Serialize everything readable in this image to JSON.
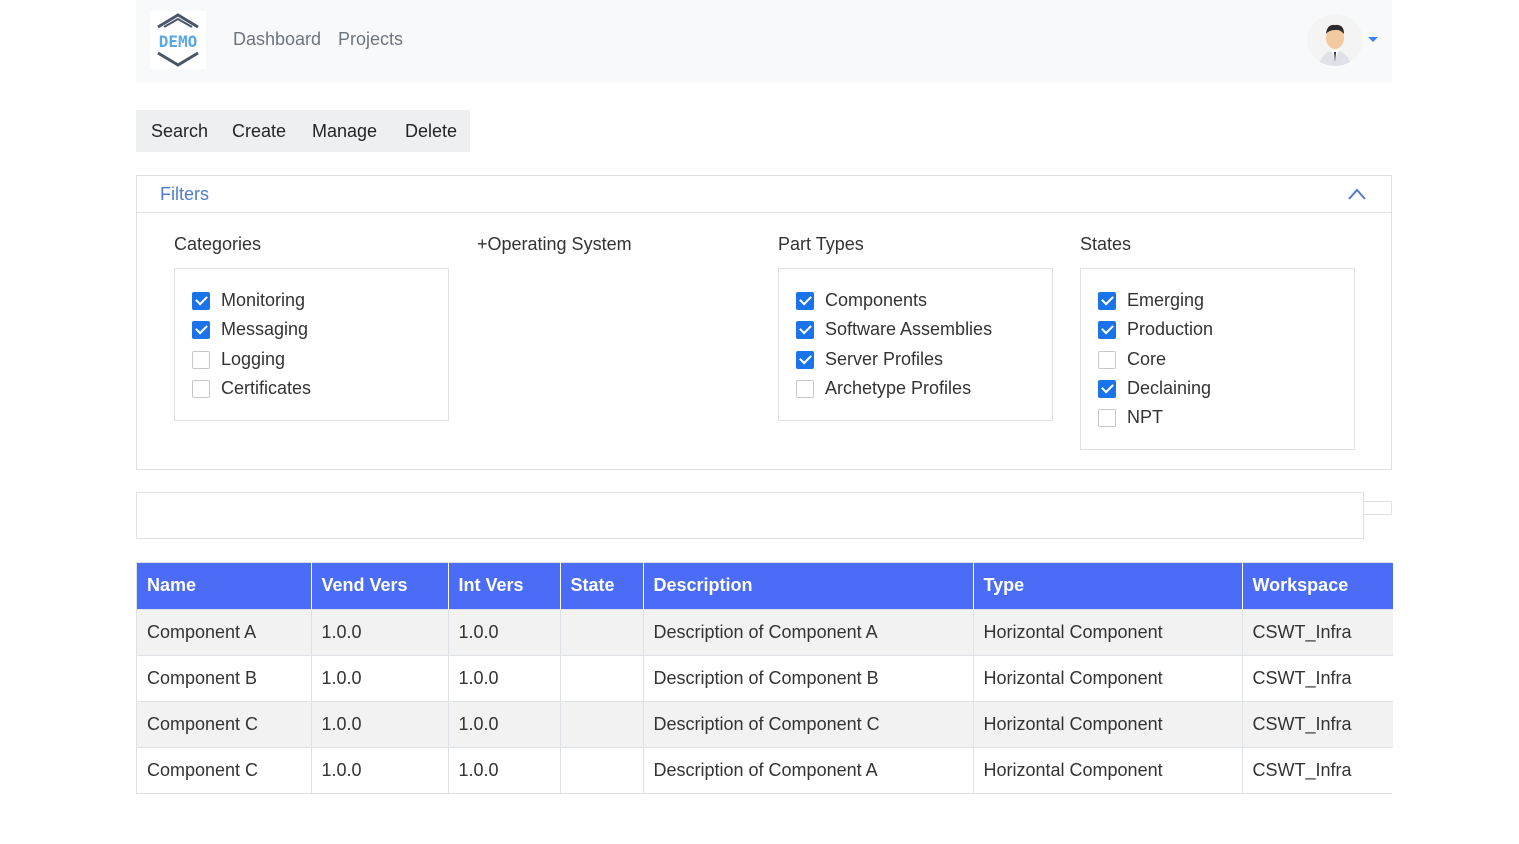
{
  "header": {
    "logo_text": "DEMO",
    "nav": [
      {
        "label": "Dashboard"
      },
      {
        "label": "Projects"
      }
    ]
  },
  "actions": [
    {
      "label": "Search"
    },
    {
      "label": "Create"
    },
    {
      "label": "Manage"
    },
    {
      "label": "Delete"
    }
  ],
  "filters": {
    "title": "Filters",
    "categories": {
      "label": "Categories",
      "items": [
        {
          "label": "Monitoring",
          "checked": true
        },
        {
          "label": "Messaging",
          "checked": true
        },
        {
          "label": "Logging",
          "checked": false
        },
        {
          "label": "Certificates",
          "checked": false
        }
      ]
    },
    "operating_system": {
      "label": "+Operating System"
    },
    "part_types": {
      "label": "Part Types",
      "items": [
        {
          "label": "Components",
          "checked": true
        },
        {
          "label": "Software Assemblies",
          "checked": true
        },
        {
          "label": "Server Profiles",
          "checked": true
        },
        {
          "label": "Archetype Profiles",
          "checked": false
        }
      ]
    },
    "states": {
      "label": "States",
      "items": [
        {
          "label": "Emerging",
          "checked": true
        },
        {
          "label": "Production",
          "checked": true
        },
        {
          "label": "Core",
          "checked": false
        },
        {
          "label": "Declaining",
          "checked": true
        },
        {
          "label": "NPT",
          "checked": false
        }
      ]
    }
  },
  "table": {
    "columns": [
      "Name",
      "Vend Vers",
      "Int Vers",
      "State",
      "Description",
      "Type",
      "Workspace"
    ],
    "rows": [
      [
        "Component A",
        "1.0.0",
        "1.0.0",
        "",
        "Description of Component A",
        "Horizontal Component",
        "CSWT_Infra"
      ],
      [
        "Component B",
        "1.0.0",
        "1.0.0",
        "",
        "Description of Component B",
        "Horizontal Component",
        "CSWT_Infra"
      ],
      [
        "Component C",
        "1.0.0",
        "1.0.0",
        "",
        "Description of Component C",
        "Horizontal Component",
        "CSWT_Infra"
      ],
      [
        "Component C",
        "1.0.0",
        "1.0.0",
        "",
        "Description of Component A",
        "Horizontal Component",
        "CSWT_Infra"
      ]
    ]
  },
  "colors": {
    "accent": "#1a73e8",
    "table_header": "#4b6cf6",
    "filters_title": "#4e7ccf"
  }
}
